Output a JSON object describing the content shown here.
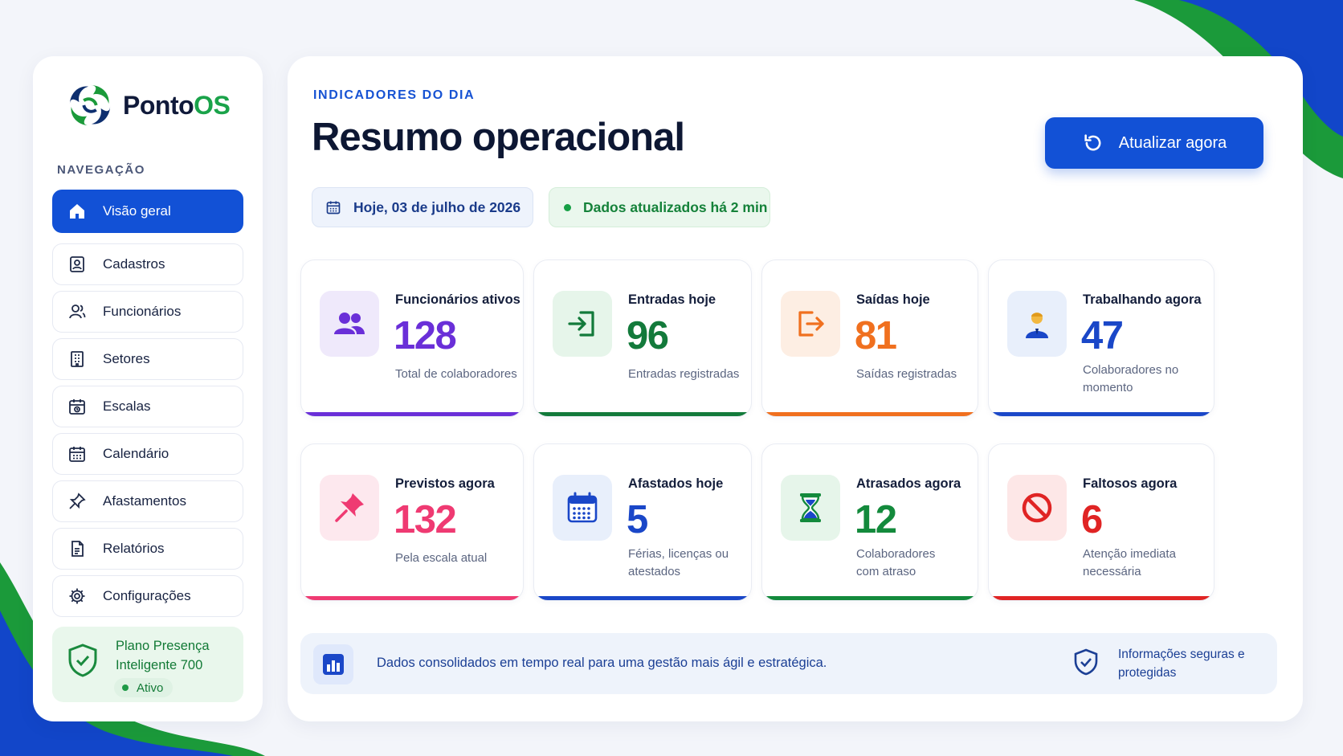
{
  "brand": {
    "name_part1": "Ponto",
    "name_part2": "OS",
    "logo_icon": "swirl-logo"
  },
  "nav": {
    "title": "NAVEGAÇÃO",
    "items": [
      {
        "label": "Visão geral",
        "icon": "home-icon",
        "active": true
      },
      {
        "label": "Cadastros",
        "icon": "id-card-icon"
      },
      {
        "label": "Funcionários",
        "icon": "users-icon"
      },
      {
        "label": "Setores",
        "icon": "building-icon"
      },
      {
        "label": "Escalas",
        "icon": "calendar-clock-icon"
      },
      {
        "label": "Calendário",
        "icon": "calendar-icon"
      },
      {
        "label": "Afastamentos",
        "icon": "pin-icon"
      },
      {
        "label": "Relatórios",
        "icon": "report-icon"
      },
      {
        "label": "Configurações",
        "icon": "gear-icon"
      }
    ]
  },
  "plan": {
    "name": "Plano Presença Inteligente 700",
    "status": "Ativo"
  },
  "header": {
    "eyebrow": "INDICADORES DO DIA",
    "title": "Resumo operacional",
    "refresh_label": "Atualizar agora",
    "date": "Hoje, 03 de julho de 2026",
    "updated": "Dados atualizados há 2 min"
  },
  "cards": [
    {
      "label": "Funcionários ativos",
      "value": "128",
      "sub": "Total de colaboradores",
      "icon": "users-icon",
      "color": "#6a2fd8",
      "bg": "#efe9fb"
    },
    {
      "label": "Entradas hoje",
      "value": "96",
      "sub": "Entradas registradas",
      "icon": "login-icon",
      "color": "#137a3b",
      "bg": "#e6f5ea"
    },
    {
      "label": "Saídas hoje",
      "value": "81",
      "sub": "Saídas registradas",
      "icon": "logout-icon",
      "color": "#f0701f",
      "bg": "#fdeee3"
    },
    {
      "label": "Trabalhando agora",
      "value": "47",
      "sub": "Colaboradores no momento",
      "icon": "worker-icon",
      "color": "#1a47c8",
      "bg": "#e8effb"
    },
    {
      "label": "Previstos agora",
      "value": "132",
      "sub": "Pela escala atual",
      "icon": "pushpin-icon",
      "color": "#ef3a72",
      "bg": "#fde8ee"
    },
    {
      "label": "Afastados hoje",
      "value": "5",
      "sub": "Férias, licenças ou atestados",
      "icon": "calendar-icon",
      "color": "#1a47c8",
      "bg": "#e8effb"
    },
    {
      "label": "Atrasados agora",
      "value": "12",
      "sub": "Colaboradores com atraso",
      "icon": "hourglass-icon",
      "color": "#138a3c",
      "bg": "#e6f5ea"
    },
    {
      "label": "Faltosos agora",
      "value": "6",
      "sub": "Atenção imediata necessária",
      "icon": "prohibited-icon",
      "color": "#e02424",
      "bg": "#fde7e7"
    }
  ],
  "footer": {
    "text": "Dados consolidados em tempo real para uma gestão mais ágil e estratégica.",
    "secure": "Informações seguras e protegidas"
  }
}
